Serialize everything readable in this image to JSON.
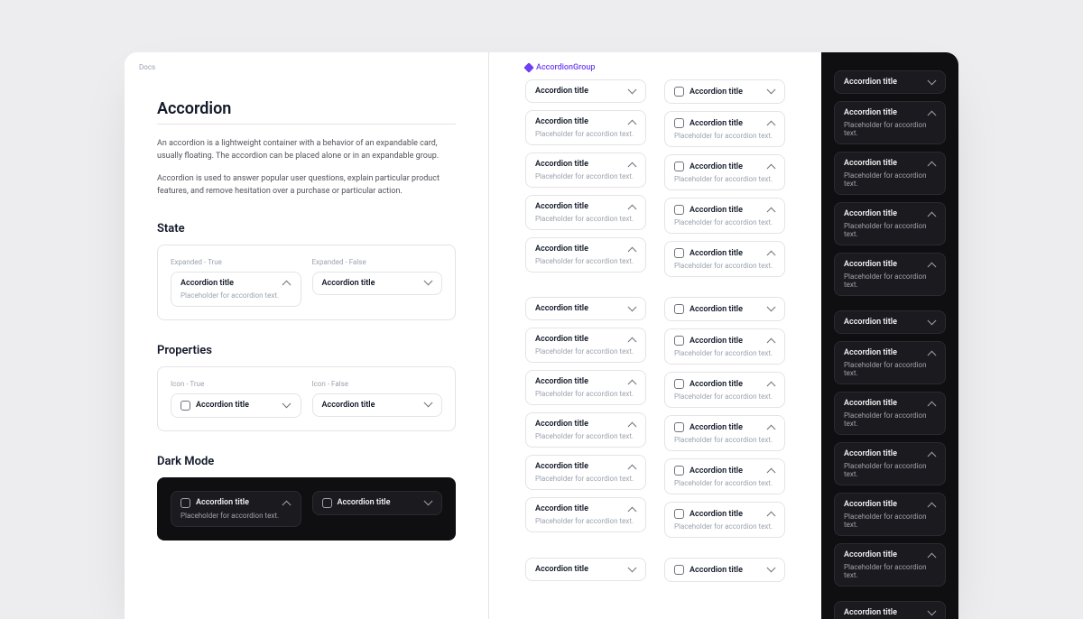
{
  "breadcrumb": "Docs",
  "title": "Accordion",
  "intro_p1": "An accordion is a lightweight container with a behavior of an expandable card, usually floating. The accordion can be placed alone or in an expandable group.",
  "intro_p2": "Accordion is used to answer popular user questions, explain particular product features, and remove hesitation over a purchase or particular action.",
  "section_state": "State",
  "section_properties": "Properties",
  "section_darkmode": "Dark Mode",
  "labels": {
    "expanded_true": "Expanded - True",
    "expanded_false": "Expanded - False",
    "icon_true": "Icon - True",
    "icon_false": "Icon - False"
  },
  "acc_title": "Accordion title",
  "acc_body": "Placeholder for accordion text.",
  "group_label": "AccordionGroup",
  "grid_light": [
    [
      {
        "icon": false,
        "expanded": false
      },
      {
        "icon": false,
        "expanded": true
      },
      {
        "icon": false,
        "expanded": true
      },
      {
        "icon": false,
        "expanded": true
      },
      {
        "icon": false,
        "expanded": true
      }
    ],
    [
      {
        "icon": true,
        "expanded": false
      },
      {
        "icon": true,
        "expanded": true
      },
      {
        "icon": true,
        "expanded": true
      },
      {
        "icon": true,
        "expanded": true
      },
      {
        "icon": true,
        "expanded": true
      }
    ],
    [
      {
        "icon": false,
        "expanded": false
      },
      {
        "icon": false,
        "expanded": true
      },
      {
        "icon": false,
        "expanded": true
      },
      {
        "icon": false,
        "expanded": true
      },
      {
        "icon": false,
        "expanded": true
      },
      {
        "icon": false,
        "expanded": true
      }
    ],
    [
      {
        "icon": true,
        "expanded": false
      },
      {
        "icon": true,
        "expanded": true
      },
      {
        "icon": true,
        "expanded": true
      },
      {
        "icon": true,
        "expanded": true
      },
      {
        "icon": true,
        "expanded": true
      },
      {
        "icon": true,
        "expanded": true
      }
    ],
    [
      {
        "icon": false,
        "expanded": false
      }
    ],
    [
      {
        "icon": true,
        "expanded": false
      }
    ]
  ],
  "grid_dark": [
    {
      "expanded": false
    },
    {
      "expanded": true
    },
    {
      "expanded": true
    },
    {
      "expanded": true
    },
    {
      "expanded": true
    },
    "spacer",
    {
      "expanded": false
    },
    {
      "expanded": true
    },
    {
      "expanded": true
    },
    {
      "expanded": true
    },
    {
      "expanded": true
    },
    {
      "expanded": true
    },
    "spacer",
    {
      "expanded": false
    }
  ]
}
